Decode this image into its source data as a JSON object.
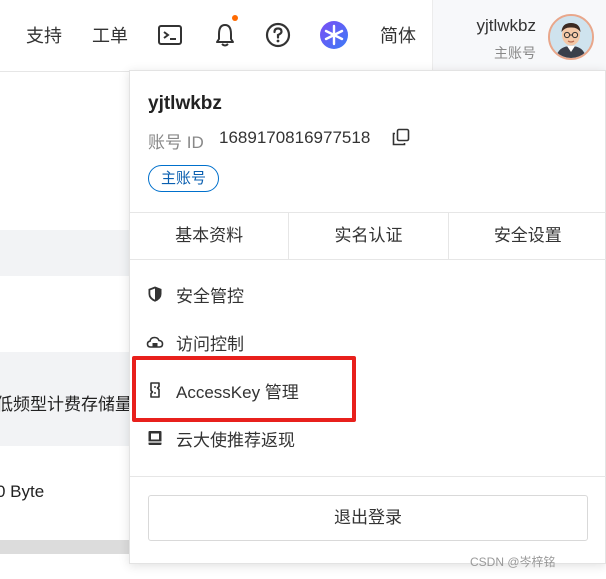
{
  "topbar": {
    "support": "支持",
    "ticket": "工单",
    "language": "简体",
    "user_name": "yjtlwkbz",
    "user_role": "主账号",
    "icons": [
      "terminal-icon",
      "bell-icon",
      "help-icon",
      "app-logo-icon"
    ],
    "notification_dot_color": "#ff6a00"
  },
  "background": {
    "row_text": "低频型计费存储量",
    "size_text": "0 Byte"
  },
  "panel": {
    "name": "yjtlwkbz",
    "id_label": "账号 ID",
    "id_value": "1689170816977518",
    "badge": "主账号",
    "tabs": [
      "基本资料",
      "实名认证",
      "安全设置"
    ],
    "menu": [
      {
        "label": "安全管控",
        "icon": "shield-icon"
      },
      {
        "label": "访问控制",
        "icon": "cloud-icon"
      },
      {
        "label": "AccessKey 管理",
        "icon": "key-icon"
      },
      {
        "label": "云大使推荐返现",
        "icon": "book-icon"
      }
    ],
    "logout": "退出登录",
    "highlight_color": "#e8201c",
    "accent_color": "#0070cc"
  },
  "watermark": "CSDN @岑梓铭"
}
